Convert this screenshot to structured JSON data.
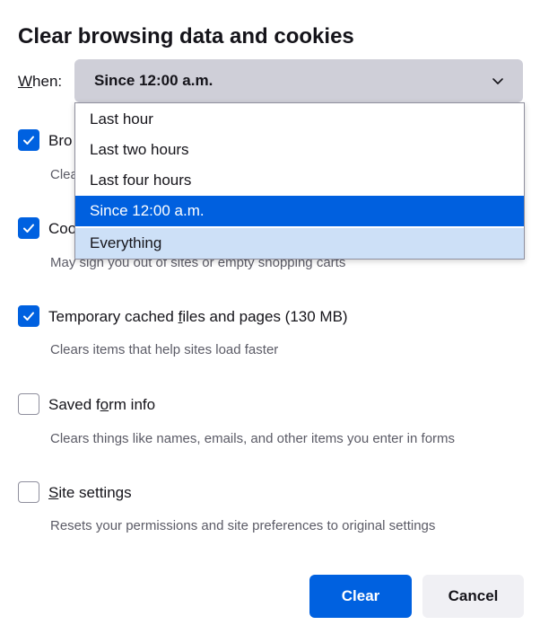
{
  "dialog": {
    "title": "Clear browsing data and cookies"
  },
  "when": {
    "label_accesskey": "W",
    "label_rest": "hen:",
    "selected": "Since 12:00 a.m.",
    "options": [
      "Last hour",
      "Last two hours",
      "Last four hours",
      "Since 12:00 a.m.",
      "Everything"
    ],
    "hovered_option": "Everything"
  },
  "items": [
    {
      "label_pre": "Bro",
      "label_ak": "",
      "label_post": "",
      "description": "Clea",
      "checked": true
    },
    {
      "label_pre": "Coo",
      "label_ak": "",
      "label_post": "",
      "description": "May sign you out of sites or empty shopping carts",
      "checked": true
    },
    {
      "label_pre": "Temporary cached ",
      "label_ak": "f",
      "label_post": "iles and pages (130 MB)",
      "description": "Clears items that help sites load faster",
      "checked": true
    },
    {
      "label_pre": "Saved f",
      "label_ak": "o",
      "label_post": "rm info",
      "description": "Clears things like names, emails, and other items you enter in forms",
      "checked": false
    },
    {
      "label_pre": "",
      "label_ak": "S",
      "label_post": "ite settings",
      "description": "Resets your permissions and site preferences to original settings",
      "checked": false
    }
  ],
  "buttons": {
    "clear": "Clear",
    "cancel": "Cancel"
  },
  "colors": {
    "accent": "#0061e0",
    "selected_option": "#0060df",
    "hovered_option": "#cde0f7",
    "select_bg": "#cfcfd8",
    "secondary_button_bg": "#f0f0f4"
  }
}
